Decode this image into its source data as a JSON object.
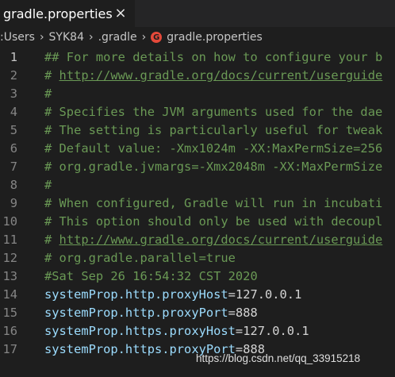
{
  "tab": {
    "title": "gradle.properties",
    "close_glyph": "×"
  },
  "breadcrumb": {
    "items": [
      ": ",
      "Users",
      "SYK84",
      ".gradle",
      "gradle.properties"
    ],
    "file_icon": "gradle-icon"
  },
  "editor": {
    "lines": [
      {
        "num": "1",
        "text": "## For more details on how to configure your b"
      },
      {
        "num": "2",
        "text": "# http://www.gradle.org/docs/current/userguide"
      },
      {
        "num": "3",
        "text": "#"
      },
      {
        "num": "4",
        "text": "# Specifies the JVM arguments used for the dae"
      },
      {
        "num": "5",
        "text": "# The setting is particularly useful for tweak"
      },
      {
        "num": "6",
        "text": "# Default value: -Xmx1024m -XX:MaxPermSize=256"
      },
      {
        "num": "7",
        "text": "# org.gradle.jvmargs=-Xmx2048m -XX:MaxPermSize"
      },
      {
        "num": "8",
        "text": "#"
      },
      {
        "num": "9",
        "text": "# When configured, Gradle will run in incubati"
      },
      {
        "num": "10",
        "text": "# This option should only be used with decoupl"
      },
      {
        "num": "11",
        "text": "# http://www.gradle.org/docs/current/userguide"
      },
      {
        "num": "12",
        "text": "# org.gradle.parallel=true"
      },
      {
        "num": "13",
        "text": "#Sat Sep 26 16:54:32 CST 2020"
      },
      {
        "num": "14",
        "key": "systemProp.http.proxyHost",
        "eq": "=",
        "value": "127.0.0.1"
      },
      {
        "num": "15",
        "key": "systemProp.http.proxyPort",
        "eq": "=",
        "value": "888"
      },
      {
        "num": "16",
        "key": "systemProp.https.proxyHost",
        "eq": "=",
        "value": "127.0.0.1"
      },
      {
        "num": "17",
        "key": "systemProp.https.proxyPort",
        "eq": "=",
        "value": "888"
      }
    ]
  },
  "watermark": "https://blog.csdn.net/qq_33915218",
  "colors": {
    "background": "#1e1e1e",
    "comment": "#6a9955",
    "key": "#9cdcfe",
    "text": "#d4d4d4",
    "line_number": "#858585"
  }
}
